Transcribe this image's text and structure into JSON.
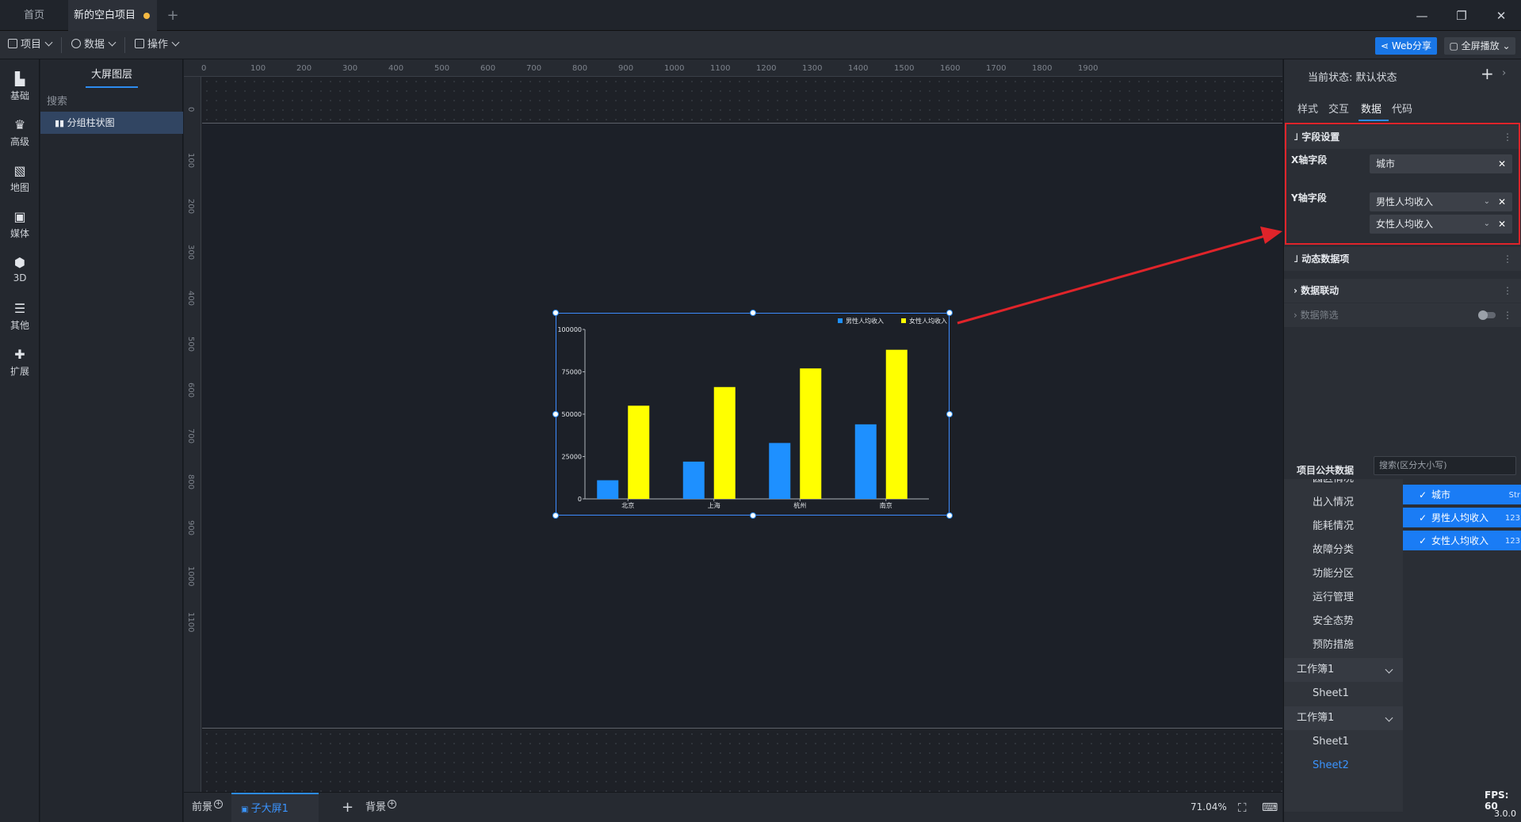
{
  "tabs": [
    {
      "label": "首页"
    },
    {
      "label": "新的空白项目"
    }
  ],
  "window": {
    "minimize": "—",
    "restore": "❐",
    "close": "✕",
    "new_tab": "+"
  },
  "menu": {
    "project": "项目",
    "data": "数据",
    "operation": "操作",
    "web_share": "Web分享",
    "fullscreen": "全屏播放"
  },
  "rail": [
    {
      "label": "基础",
      "icon": "bar-chart-icon"
    },
    {
      "label": "高级",
      "icon": "crown-icon"
    },
    {
      "label": "地图",
      "icon": "map-icon"
    },
    {
      "label": "媒体",
      "icon": "media-icon"
    },
    {
      "label": "3D",
      "icon": "cube-icon"
    },
    {
      "label": "其他",
      "icon": "list-icon"
    },
    {
      "label": "扩展",
      "icon": "puzzle-icon"
    }
  ],
  "layers": {
    "title": "大屏图层",
    "search": "搜索",
    "item": "分组柱状图"
  },
  "ruler": {
    "h": [
      "0",
      "100",
      "200",
      "300",
      "400",
      "500",
      "600",
      "700",
      "800",
      "900",
      "1000",
      "1100",
      "1200",
      "1300",
      "1400",
      "1500",
      "1600",
      "1700",
      "1800",
      "1900"
    ],
    "v": [
      "0",
      "100",
      "200",
      "300",
      "400",
      "500",
      "600",
      "700",
      "800",
      "900",
      "1000",
      "1100"
    ]
  },
  "chart_data": {
    "type": "bar",
    "categories": [
      "北京",
      "上海",
      "杭州",
      "南京"
    ],
    "series": [
      {
        "name": "男性人均收入",
        "values": [
          11000,
          22000,
          33000,
          44000
        ],
        "color": "#1e90ff"
      },
      {
        "name": "女性人均收入",
        "values": [
          55000,
          66000,
          77000,
          88000
        ],
        "color": "#ffff00"
      }
    ],
    "yticks": [
      "0",
      "25000",
      "50000",
      "75000",
      "100000"
    ],
    "ylim": [
      0,
      100000
    ],
    "legend": "top-right",
    "grid": false
  },
  "right": {
    "state_label": "当前状态:  默认状态",
    "plus": "+",
    "arrow": "›",
    "tabs": [
      "样式",
      "交互",
      "数据",
      "代码"
    ],
    "sections": {
      "field": "字段设置",
      "dynamic": "动态数据项",
      "linkage": "数据联动",
      "filter": "数据筛选"
    },
    "x_label": "X轴字段",
    "y_label": "Y轴字段",
    "x_field": "城市",
    "y_fields": [
      "男性人均收入",
      "女性人均收入"
    ],
    "pub_title": "项目公共数据",
    "pub_search": "搜索(区分大小写)",
    "pub_list": [
      "园区情况",
      "出入情况",
      "能耗情况",
      "故障分类",
      "功能分区",
      "运行管理",
      "安全态势",
      "预防措施",
      "工作簿1",
      "Sheet1",
      "工作簿1",
      "Sheet1",
      "Sheet2"
    ],
    "pub_fields": [
      {
        "name": "城市",
        "type": "Str"
      },
      {
        "name": "男性人均收入",
        "type": "123"
      },
      {
        "name": "女性人均收入",
        "type": "123"
      }
    ],
    "fps": "FPS: 60",
    "version": "3.0.0"
  },
  "bottom": {
    "front": "前景",
    "sub": "子大屏1",
    "add": "+",
    "back": "背景",
    "zoom": "71.04%"
  },
  "colors": {
    "accent": "#2d8cf0",
    "highlight_border": "#e0242a"
  }
}
